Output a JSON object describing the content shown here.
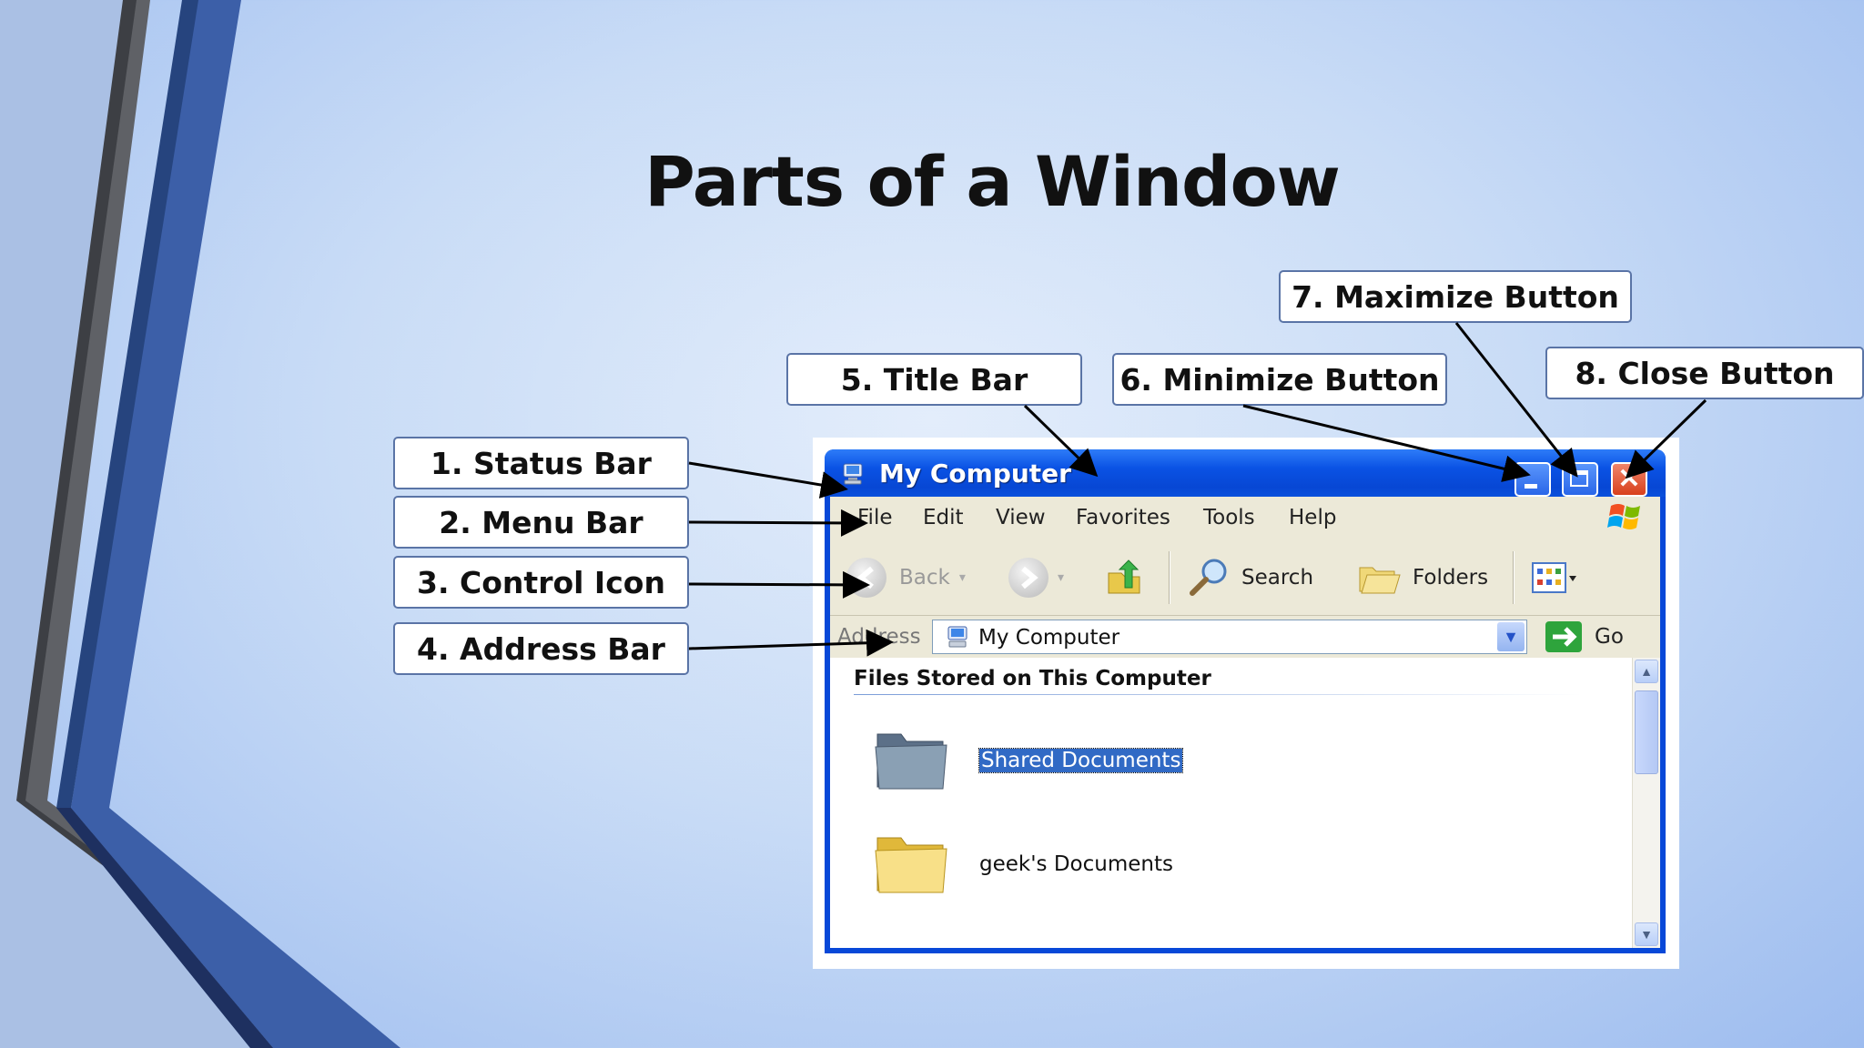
{
  "slide": {
    "title": "Parts of a Window"
  },
  "callouts": {
    "status_bar": "1. Status Bar",
    "menu_bar": "2. Menu Bar",
    "control_icon": "3. Control Icon",
    "address_bar": "4. Address Bar",
    "title_bar": "5. Title Bar",
    "minimize_button": "6. Minimize Button",
    "maximize_button": "7. Maximize Button",
    "close_button": "8. Close Button"
  },
  "window": {
    "title": "My Computer",
    "close_glyph": "✕",
    "menu": [
      "File",
      "Edit",
      "View",
      "Favorites",
      "Tools",
      "Help"
    ],
    "toolbar": {
      "back": "Back",
      "search": "Search",
      "folders": "Folders"
    },
    "address": {
      "label": "Address",
      "value": "My Computer",
      "go": "Go"
    },
    "content": {
      "group_header": "Files Stored on This Computer",
      "items": [
        "Shared Documents",
        "geek's Documents"
      ]
    },
    "colors": {
      "titlebar": "#0a52e4",
      "chrome": "#ece9d8",
      "selection": "#316ac5"
    }
  }
}
